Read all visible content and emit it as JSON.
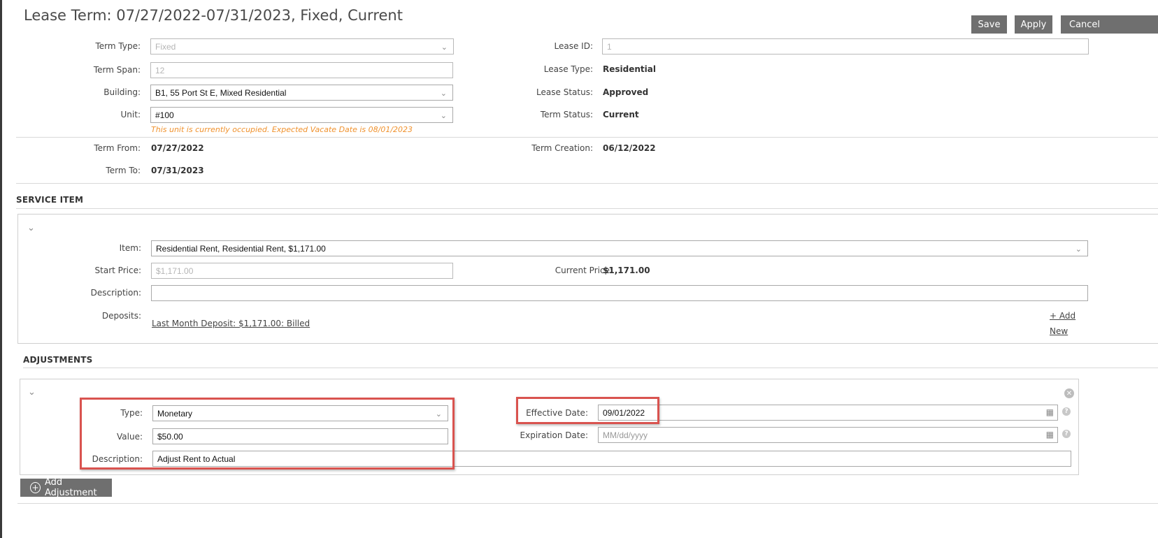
{
  "page": {
    "title": "Lease Term: 07/27/2022-07/31/2023, Fixed, Current"
  },
  "toolbar": {
    "save_label": "Save",
    "apply_label": "Apply",
    "cancel_label": "Cancel"
  },
  "term": {
    "term_type_label": "Term Type:",
    "term_type_value": "Fixed",
    "term_span_label": "Term Span:",
    "term_span_value": "12",
    "building_label": "Building:",
    "building_value": "B1,  55 Port St E, Mixed Residential",
    "unit_label": "Unit:",
    "unit_value": "#100",
    "unit_warning": "This unit is currently occupied. Expected Vacate Date is 08/01/2023",
    "lease_id_label": "Lease ID:",
    "lease_id_value": "1",
    "lease_type_label": "Lease Type:",
    "lease_type_value": "Residential",
    "lease_status_label": "Lease Status:",
    "lease_status_value": "Approved",
    "term_status_label": "Term Status:",
    "term_status_value": "Current",
    "term_from_label": "Term From:",
    "term_from_value": "07/27/2022",
    "term_to_label": "Term To:",
    "term_to_value": "07/31/2023",
    "term_creation_label": "Term Creation:",
    "term_creation_value": "06/12/2022"
  },
  "service_item": {
    "section_title": "SERVICE ITEM",
    "item_label": "Item:",
    "item_value": "Residential Rent, Residential Rent, $1,171.00",
    "start_price_label": "Start Price:",
    "start_price_value": "$1,171.00",
    "current_price_label": "Current Price:",
    "current_price_value": "$1,171.00",
    "description_label": "Description:",
    "description_value": "",
    "deposits_label": "Deposits:",
    "deposit_link": "Last Month Deposit: $1,171.00: Billed",
    "add_new_line1": "+ Add",
    "add_new_line2": "New"
  },
  "adjustments": {
    "section_title": "ADJUSTMENTS",
    "type_label": "Type:",
    "type_value": "Monetary",
    "value_label": "Value:",
    "value_value": "$50.00",
    "description_label": "Description:",
    "description_value": "Adjust Rent to Actual",
    "effective_date_label": "Effective Date:",
    "effective_date_value": "09/01/2022",
    "expiration_date_label": "Expiration Date:",
    "expiration_date_placeholder": "MM/dd/yyyy",
    "add_adjustment_label": "Add Adjustment"
  },
  "icons": {
    "chevron": "chevron-down-icon",
    "calendar": "calendar-icon",
    "help": "help-icon",
    "remove": "remove-circle-icon",
    "add": "plus-circle-icon"
  },
  "colors": {
    "button": "#6f6f6f",
    "highlight": "#d9534f",
    "warning": "#f0922e"
  }
}
